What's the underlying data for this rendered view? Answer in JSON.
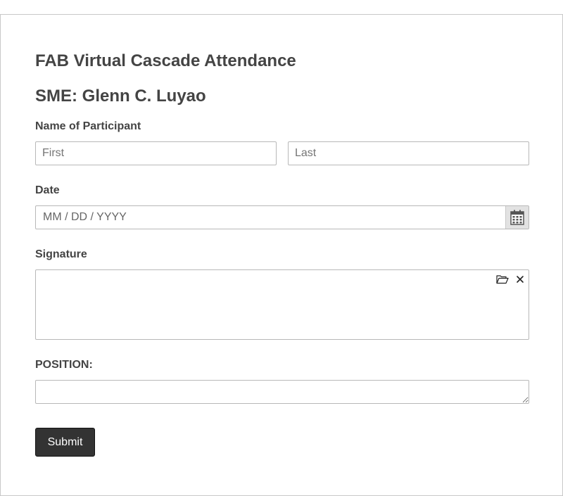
{
  "form": {
    "title": "FAB Virtual Cascade Attendance",
    "subtitle": "SME: Glenn C. Luyao"
  },
  "fields": {
    "name": {
      "label": "Name of Participant",
      "first_placeholder": "First",
      "first_value": "",
      "last_placeholder": "Last",
      "last_value": ""
    },
    "date": {
      "label": "Date",
      "placeholder": "MM / DD / YYYY",
      "value": "",
      "icon": "calendar-icon"
    },
    "signature": {
      "label": "Signature",
      "tools": [
        "folder-open-icon",
        "close-icon"
      ]
    },
    "position": {
      "label": "POSITION:",
      "value": ""
    }
  },
  "actions": {
    "submit_label": "Submit"
  },
  "colors": {
    "text": "#444444",
    "border": "#b8b8b8",
    "button_bg": "#333333",
    "button_text": "#ffffff",
    "calendar_bg": "#e2e2e2"
  }
}
